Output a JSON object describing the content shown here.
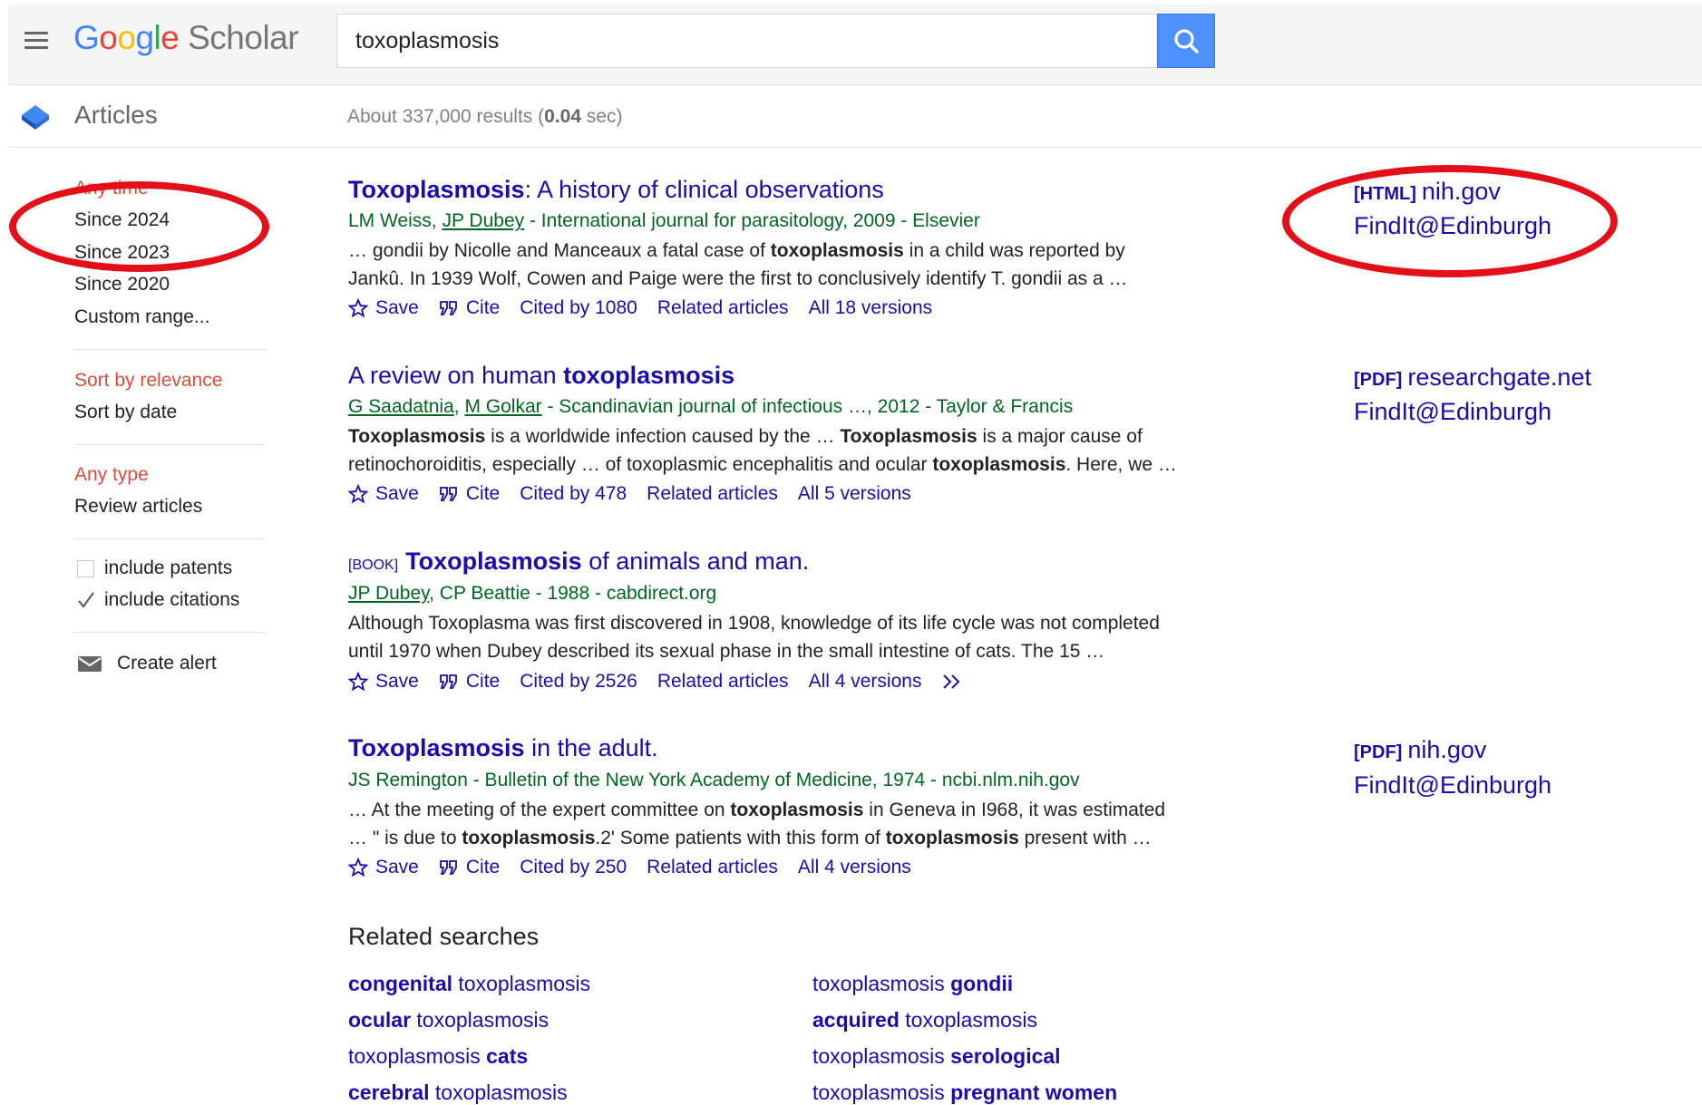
{
  "header": {
    "logo_google": "Google",
    "logo_scholar": "Scholar",
    "search_value": "toxoplasmosis",
    "search_placeholder": "",
    "colors": {
      "search_button": "#4d90fe",
      "link": "#1a0dab",
      "green": "#006621",
      "red": "#dd4b39",
      "annotation": "#e3101a"
    }
  },
  "subheader": {
    "articles_label": "Articles",
    "stats_prefix": "About 337,000 results (",
    "stats_time": "0.04",
    "stats_suffix": " sec)"
  },
  "sidebar": {
    "time": [
      "Any time",
      "Since 2024",
      "Since 2023",
      "Since 2020",
      "Custom range..."
    ],
    "sort": [
      "Sort by relevance",
      "Sort by date"
    ],
    "type": [
      "Any type",
      "Review articles"
    ],
    "include_patents": {
      "label": "include patents",
      "checked": false
    },
    "include_citations": {
      "label": "include citations",
      "checked": true
    },
    "create_alert": "Create alert"
  },
  "results": [
    {
      "tag": "",
      "title_bold": "Toxoplasmosis",
      "title_rest": ": A history of clinical observations",
      "authors": [
        "LM Weiss",
        "JP Dubey"
      ],
      "authors_linked": [
        false,
        true
      ],
      "meta_rest": " - International journal for parasitology, 2009 - Elsevier",
      "snippet_line1_a": "… gondii by Nicolle and Manceaux a fatal case of ",
      "snippet_line1_b": "toxoplasmosis",
      "snippet_line1_c": " in a child was reported by",
      "snippet_line2": "Jankû. In 1939 Wolf, Cowen and Paige were the first to conclusively identify T. gondii as a …",
      "save": "Save",
      "cite": "Cite",
      "cited_by": "Cited by 1080",
      "related": "Related articles",
      "versions": "All 18 versions",
      "side_tag": "[HTML]",
      "side_source": "nih.gov",
      "side_findit": "FindIt@Edinburgh"
    },
    {
      "tag": "",
      "title_pre": "A review on human ",
      "title_bold": "toxoplasmosis",
      "authors": [
        "G Saadatnia",
        "M Golkar"
      ],
      "meta_rest": " - Scandinavian journal of infectious …, 2012 - Taylor & Francis",
      "snippet_line1_a": "Toxoplasmosis",
      "snippet_line1_b": " is a worldwide infection caused by the … ",
      "snippet_line1_c": "Toxoplasmosis",
      "snippet_line1_d": " is a major cause of",
      "snippet_line2_a": "retinochoroiditis, especially … of toxoplasmic encephalitis and ocular ",
      "snippet_line2_b": "toxoplasmosis",
      "snippet_line2_c": ". Here, we …",
      "save": "Save",
      "cite": "Cite",
      "cited_by": "Cited by 478",
      "related": "Related articles",
      "versions": "All 5 versions",
      "side_tag": "[PDF]",
      "side_source": "researchgate.net",
      "side_findit": "FindIt@Edinburgh"
    },
    {
      "tag": "[BOOK]",
      "title_bold": "Toxoplasmosis",
      "title_rest": " of animals and man.",
      "author_link": "JP Dubey",
      "meta_rest": ", CP Beattie - 1988 - cabdirect.org",
      "snippet_line1": "Although Toxoplasma was first discovered in 1908, knowledge of its life cycle was not completed",
      "snippet_line2": "until 1970 when Dubey described its sexual phase in the small intestine of cats. The 15 …",
      "save": "Save",
      "cite": "Cite",
      "cited_by": "Cited by 2526",
      "related": "Related articles",
      "versions": "All 4 versions",
      "more": "»"
    },
    {
      "tag": "",
      "title_bold": "Toxoplasmosis",
      "title_rest": " in the adult.",
      "meta": "JS Remington - Bulletin of the New York Academy of Medicine, 1974 - ncbi.nlm.nih.gov",
      "snippet_line1_a": "… At the meeting of the expert committee on ",
      "snippet_line1_b": "toxoplasmosis",
      "snippet_line1_c": " in Geneva in I968, it was estimated",
      "snippet_line2_a": "… \" is due to ",
      "snippet_line2_b": "toxoplasmosis",
      "snippet_line2_c": ".2' Some patients with this form of ",
      "snippet_line2_d": "toxoplasmosis",
      "snippet_line2_e": " present with …",
      "save": "Save",
      "cite": "Cite",
      "cited_by": "Cited by 250",
      "related": "Related articles",
      "versions": "All 4 versions",
      "side_tag": "[PDF]",
      "side_source": "nih.gov",
      "side_findit": "FindIt@Edinburgh"
    }
  ],
  "related_searches": {
    "title": "Related searches",
    "left": [
      {
        "bold": "congenital",
        "rest": " toxoplasmosis"
      },
      {
        "bold": "ocular",
        "rest": " toxoplasmosis"
      },
      {
        "pre": "toxoplasmosis ",
        "bold": "cats"
      },
      {
        "bold": "cerebral",
        "rest": " toxoplasmosis"
      }
    ],
    "right": [
      {
        "pre": "toxoplasmosis ",
        "bold": "gondii"
      },
      {
        "bold": "acquired",
        "rest": " toxoplasmosis"
      },
      {
        "pre": "toxoplasmosis ",
        "bold": "serological"
      },
      {
        "pre": "toxoplasmosis ",
        "bold": "pregnant women"
      }
    ]
  }
}
